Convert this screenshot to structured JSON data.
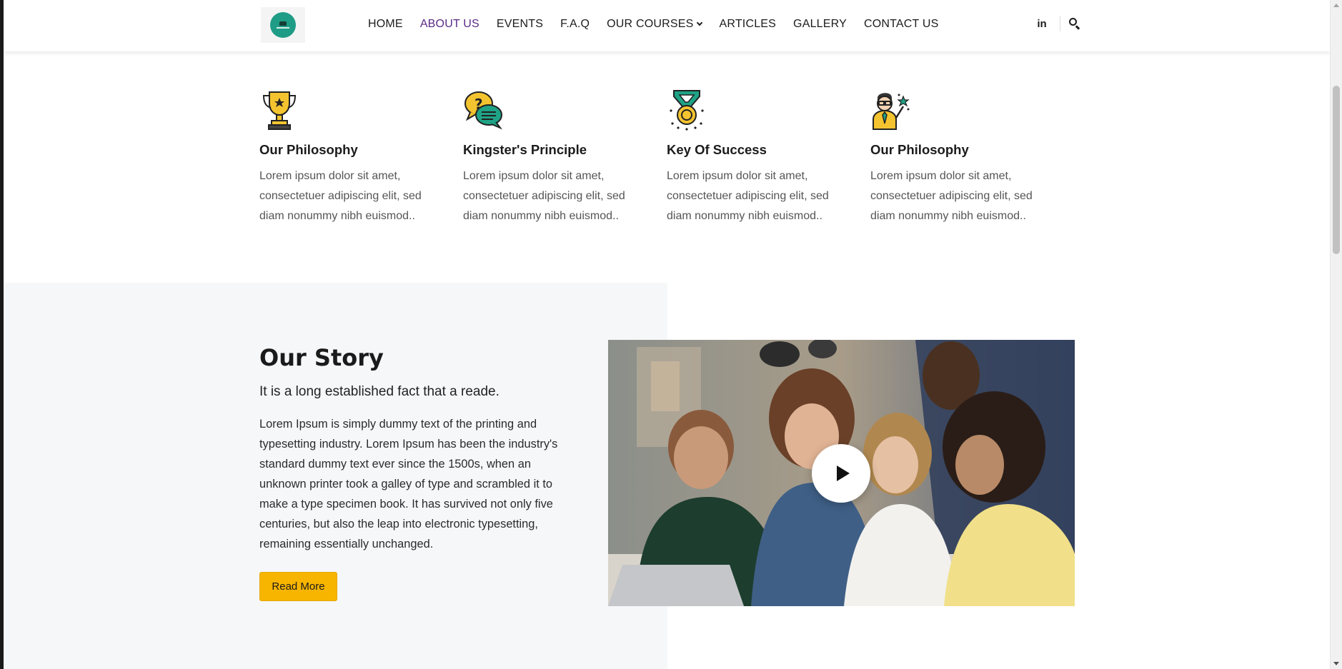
{
  "header": {
    "nav": [
      {
        "label": "HOME",
        "active": false
      },
      {
        "label": "ABOUT US",
        "active": true
      },
      {
        "label": "EVENTS",
        "active": false
      },
      {
        "label": "F.A.Q",
        "active": false
      },
      {
        "label": "OUR COURSES",
        "active": false,
        "dropdown": true
      },
      {
        "label": "ARTICLES",
        "active": false
      },
      {
        "label": "GALLERY",
        "active": false
      },
      {
        "label": "CONTACT US",
        "active": false
      }
    ],
    "linkedin_label": "in",
    "icons": {
      "logo": "school-logo",
      "social": "linkedin-icon",
      "search": "search-icon"
    },
    "colors": {
      "active_nav": "#5b2a86",
      "logo_bg": "#1f9c86",
      "button": "#f7b500"
    }
  },
  "features": [
    {
      "icon": "trophy-icon",
      "title": "Our Philosophy",
      "text": "Lorem ipsum dolor sit amet, consectetuer adipiscing elit, sed diam nonummy nibh euismod.."
    },
    {
      "icon": "chat-bubbles-icon",
      "title": "Kingster's Principle",
      "text": "Lorem ipsum dolor sit amet, consectetuer adipiscing elit, sed diam nonummy nibh euismod.."
    },
    {
      "icon": "medal-icon",
      "title": "Key Of Success",
      "text": "Lorem ipsum dolor sit amet, consectetuer adipiscing elit, sed diam nonummy nibh euismod.."
    },
    {
      "icon": "teacher-icon",
      "title": "Our Philosophy",
      "text": "Lorem ipsum dolor sit amet, consectetuer adipiscing elit, sed diam nonummy nibh euismod.."
    }
  ],
  "story": {
    "title": "Our Story",
    "subtitle": "It is a long established fact that a reade.",
    "body": "Lorem Ipsum is simply dummy text of the printing and typesetting industry. Lorem Ipsum has been the industry's standard dummy text ever since the 1500s, when an unknown printer took a galley of type and scrambled it to make a type specimen book. It has survived not only five centuries, but also the leap into electronic typesetting, remaining essentially unchanged.",
    "button_label": "Read More",
    "video_icon": "play-icon"
  }
}
